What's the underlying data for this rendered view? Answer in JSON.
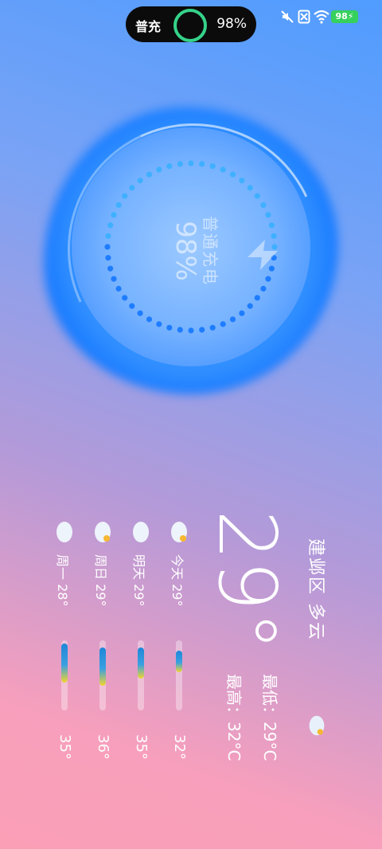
{
  "status_bar": {
    "charge_mode": "普充",
    "charge_percent": "98%",
    "battery_badge": "98",
    "icons": [
      "mute-icon",
      "no-sim-icon",
      "wifi-icon",
      "battery-icon"
    ],
    "accent_ring": "#35d28a"
  },
  "charging": {
    "label": "普通充电",
    "percent": "98%",
    "icon": "lightning-bolt-icon"
  },
  "weather": {
    "location": "建邺区 多云",
    "current_temp": "29°",
    "low": "最低：29°C",
    "high": "最高：32°C",
    "forecast": [
      {
        "label": "今天 29°",
        "max": "32°",
        "icon": "partly-cloudy-icon",
        "range": [
          0.15,
          0.45
        ]
      },
      {
        "label": "明天 29°",
        "max": "35°",
        "icon": "cloudy-icon",
        "range": [
          0.1,
          0.55
        ]
      },
      {
        "label": "周日 29°",
        "max": "36°",
        "icon": "partly-cloudy-icon",
        "range": [
          0.1,
          0.65
        ]
      },
      {
        "label": "周一 28°",
        "max": "35°",
        "icon": "cloudy-icon",
        "range": [
          0.05,
          0.6
        ]
      }
    ]
  }
}
